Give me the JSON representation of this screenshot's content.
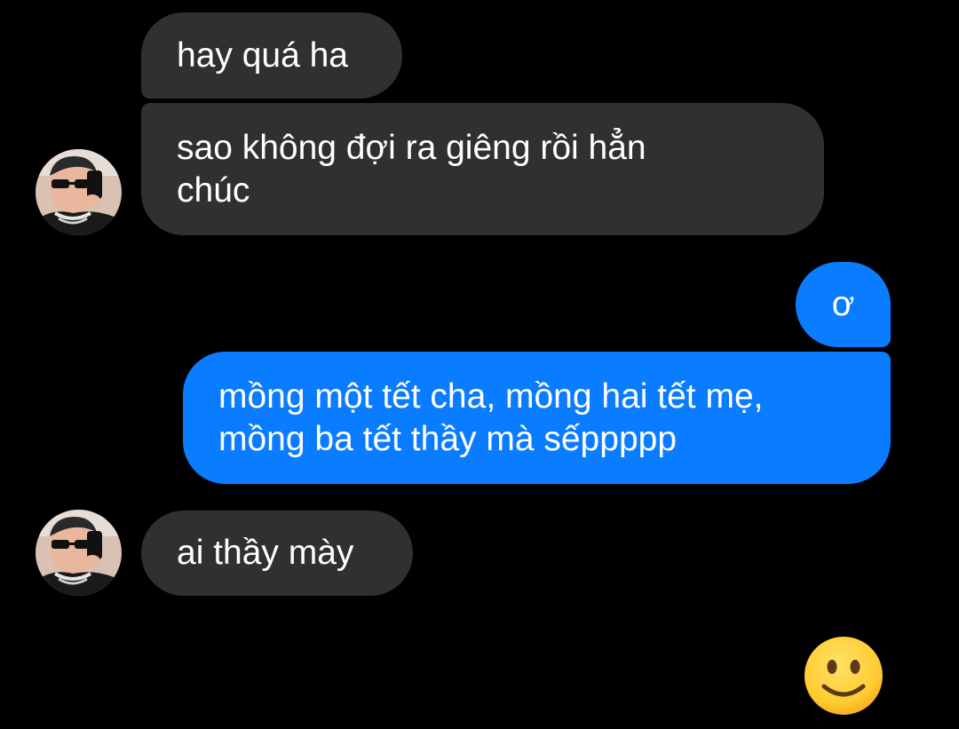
{
  "conversation": {
    "messages": [
      {
        "sender": "contact",
        "text": "hay quá ha"
      },
      {
        "sender": "contact",
        "text": "sao không đợi ra giêng rồi hẳn\nchúc"
      },
      {
        "sender": "me",
        "text": "ơ"
      },
      {
        "sender": "me",
        "text": "mồng một tết cha, mồng hai tết mẹ,\nmồng ba tết thầy mà sếppppp"
      },
      {
        "sender": "contact",
        "text": "ai thầy mày"
      }
    ],
    "reaction": {
      "icon": "slightly-smiling-face-emoji"
    }
  },
  "colors": {
    "background": "#000000",
    "incoming_bubble": "#303030",
    "outgoing_bubble": "#0a7cff",
    "emoji_face": "#ffcc33"
  }
}
